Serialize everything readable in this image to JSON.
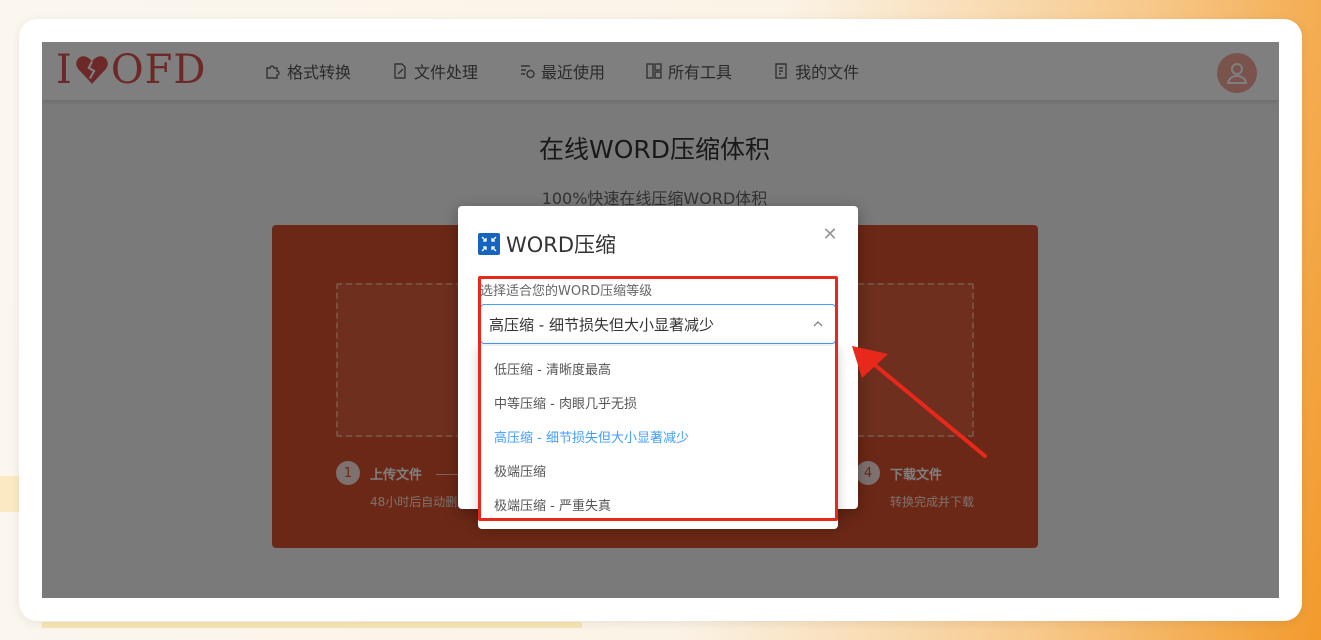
{
  "header": {
    "logo_text_left": "I",
    "logo_text_right": "OFD",
    "nav": [
      {
        "label": "格式转换",
        "icon": "puzzle-icon"
      },
      {
        "label": "文件处理",
        "icon": "file-edit-icon"
      },
      {
        "label": "最近使用",
        "icon": "recent-icon"
      },
      {
        "label": "所有工具",
        "icon": "grid-icon"
      },
      {
        "label": "我的文件",
        "icon": "my-file-icon"
      }
    ]
  },
  "main": {
    "title": "在线WORD压缩体积",
    "subtitle": "100%快速在线压缩WORD体积",
    "steps": [
      {
        "num": "1",
        "label": "上传文件",
        "desc": "48小时后自动删"
      },
      {
        "num": "4",
        "label": "下载文件",
        "desc": "转换完成并下载"
      }
    ]
  },
  "dialog": {
    "title": "WORD压缩",
    "field_label": "选择适合您的WORD压缩等级",
    "selected_value": "高压缩 - 细节损失但大小显著减少",
    "options": [
      "低压缩 - 清晰度最高",
      "中等压缩 - 肉眼几乎无损",
      "高压缩 - 细节损失但大小显著减少",
      "极端压缩",
      "极端压缩 - 严重失真"
    ],
    "selected_index": 2
  },
  "colors": {
    "brand": "#d9512c",
    "logo_red": "#d9534f",
    "select_blue": "#409eff",
    "annotation_red": "#e8281b"
  }
}
